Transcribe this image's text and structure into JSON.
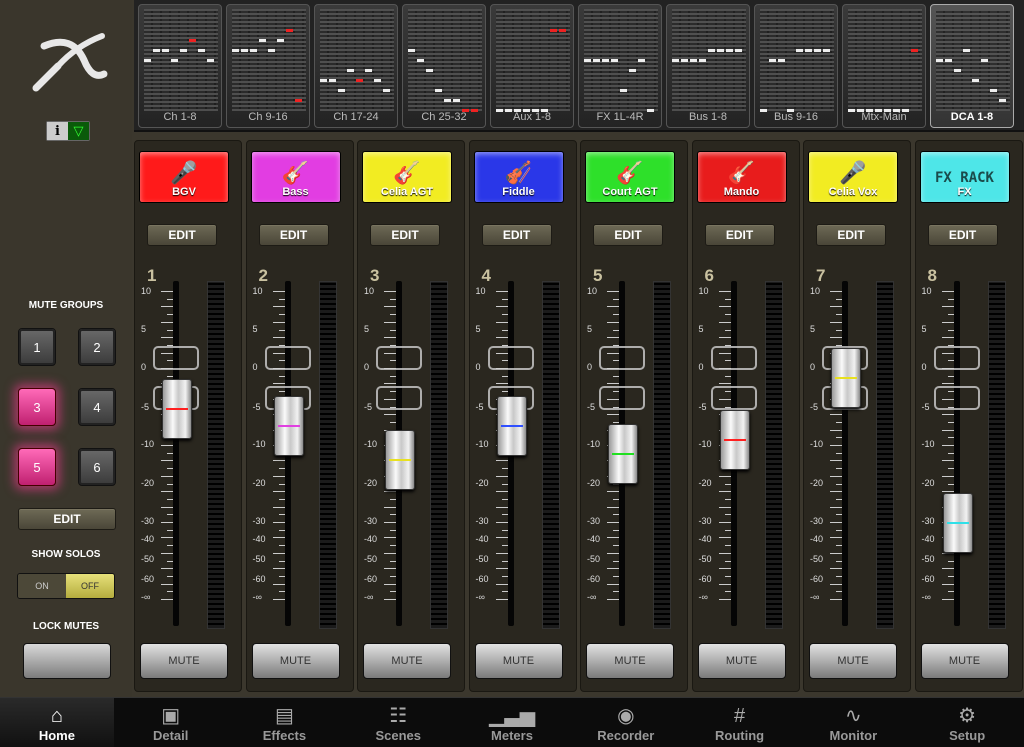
{
  "left": {
    "mute_groups_label": "MUTE GROUPS",
    "mute_groups": [
      {
        "label": "1",
        "on": false
      },
      {
        "label": "2",
        "on": false
      },
      {
        "label": "3",
        "on": true
      },
      {
        "label": "4",
        "on": false
      },
      {
        "label": "5",
        "on": true
      },
      {
        "label": "6",
        "on": false
      }
    ],
    "edit_label": "EDIT",
    "show_solos_label": "SHOW SOLOS",
    "toggle": {
      "on_label": "ON",
      "off_label": "OFF",
      "value": "OFF"
    },
    "lock_mutes_label": "LOCK MUTES",
    "info_icon": "info-icon",
    "wifi_icon": "wifi-icon"
  },
  "banks": [
    {
      "label": "Ch 1-8",
      "selected": false
    },
    {
      "label": "Ch 9-16",
      "selected": false
    },
    {
      "label": "Ch 17-24",
      "selected": false
    },
    {
      "label": "Ch 25-32",
      "selected": false
    },
    {
      "label": "Aux 1-8",
      "selected": false
    },
    {
      "label": "FX 1L-4R",
      "selected": false
    },
    {
      "label": "Bus 1-8",
      "selected": false
    },
    {
      "label": "Bus 9-16",
      "selected": false
    },
    {
      "label": "Mtx-Main",
      "selected": false
    },
    {
      "label": "DCA 1-8",
      "selected": true
    }
  ],
  "scale_labels": [
    "10",
    "5",
    "0",
    "-5",
    "-10",
    "-20",
    "-30",
    "-40",
    "-50",
    "-60",
    "-∞"
  ],
  "channels": [
    {
      "num": "1",
      "name": "BGV",
      "color": "#ff1a1a",
      "icon": "microphone-icon",
      "glyph": "🎤",
      "fader": 0.63,
      "line": "#ff2020"
    },
    {
      "num": "2",
      "name": "Bass",
      "color": "#e23de2",
      "icon": "bass-guitar-icon",
      "glyph": "🎸",
      "fader": 0.58,
      "line": "#e040e0"
    },
    {
      "num": "3",
      "name": "Celia AGT",
      "color": "#f2ec22",
      "icon": "acoustic-guitar-icon",
      "glyph": "🎸",
      "fader": 0.48,
      "line": "#e8e020"
    },
    {
      "num": "4",
      "name": "Fiddle",
      "color": "#2a37e8",
      "icon": "violin-icon",
      "glyph": "🎻",
      "fader": 0.58,
      "line": "#3050ff"
    },
    {
      "num": "5",
      "name": "Court AGT",
      "color": "#2ee02a",
      "icon": "acoustic-guitar-icon",
      "glyph": "🎸",
      "fader": 0.5,
      "line": "#20e020"
    },
    {
      "num": "6",
      "name": "Mando",
      "color": "#e81c1c",
      "icon": "mandolin-icon",
      "glyph": "🎸",
      "fader": 0.54,
      "line": "#ff2020"
    },
    {
      "num": "7",
      "name": "Celia Vox",
      "color": "#f2ec22",
      "icon": "microphone-icon",
      "glyph": "🎤",
      "fader": 0.72,
      "line": "#e8e020"
    },
    {
      "num": "8",
      "name": "FX",
      "color": "#4ee6e8",
      "icon": "fx-rack-icon",
      "glyph": "FX RACK",
      "fader": 0.3,
      "line": "#30e0e8"
    }
  ],
  "strip_edit_label": "EDIT",
  "mute_label": "MUTE",
  "tabs": [
    {
      "label": "Home",
      "icon": "home-icon",
      "glyph": "⌂",
      "active": true
    },
    {
      "label": "Detail",
      "icon": "detail-icon",
      "glyph": "▣",
      "active": false
    },
    {
      "label": "Effects",
      "icon": "effects-icon",
      "glyph": "▤",
      "active": false
    },
    {
      "label": "Scenes",
      "icon": "scenes-icon",
      "glyph": "☷",
      "active": false
    },
    {
      "label": "Meters",
      "icon": "meters-icon",
      "glyph": "▁▃▅",
      "active": false
    },
    {
      "label": "Recorder",
      "icon": "recorder-icon",
      "glyph": "◉",
      "active": false
    },
    {
      "label": "Routing",
      "icon": "routing-icon",
      "glyph": "#",
      "active": false
    },
    {
      "label": "Monitor",
      "icon": "monitor-icon",
      "glyph": "∿",
      "active": false
    },
    {
      "label": "Setup",
      "icon": "setup-icon",
      "glyph": "⚙",
      "active": false
    }
  ]
}
